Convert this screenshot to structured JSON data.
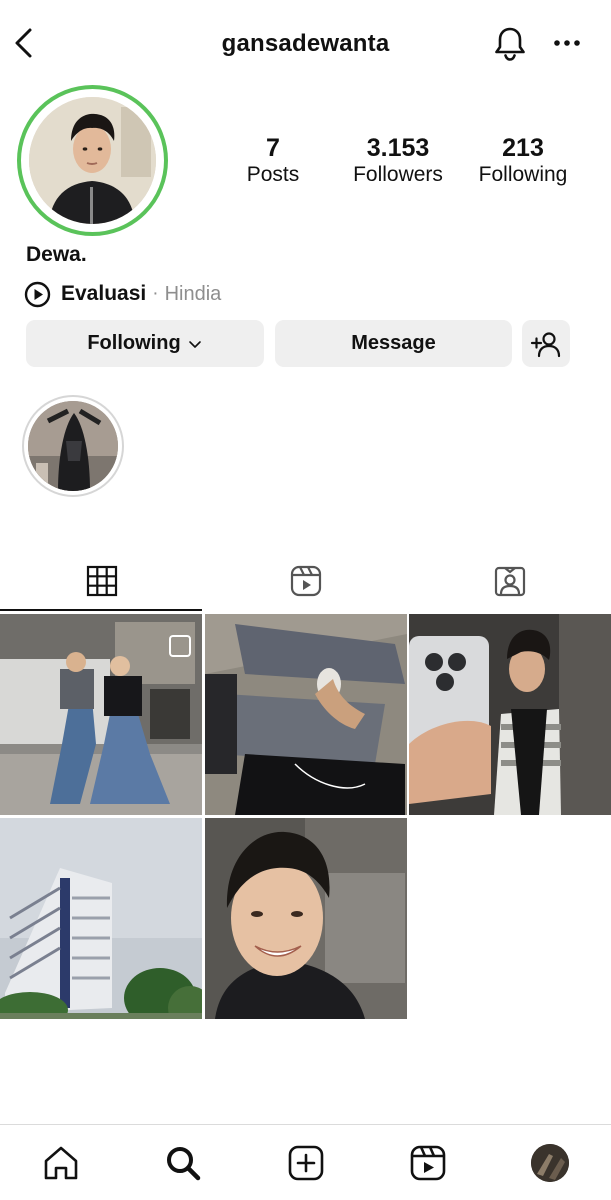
{
  "header": {
    "username": "gansadewanta",
    "icons": {
      "back": "chevron-left-icon",
      "notifications": "bell-icon",
      "more": "more-horizontal-icon"
    }
  },
  "profile": {
    "story_ring_color": "#5ac35a",
    "stats": {
      "posts": {
        "value": "7",
        "label": "Posts"
      },
      "followers": {
        "value": "3.153",
        "label": "Followers"
      },
      "following": {
        "value": "213",
        "label": "Following"
      }
    },
    "display_name": "Dewa.",
    "music": {
      "song": "Evaluasi",
      "separator": "·",
      "artist": "Hindia"
    }
  },
  "actions": {
    "following_label": "Following",
    "message_label": "Message",
    "add_user_icon": "add-user-icon"
  },
  "tabs": [
    {
      "name": "posts-grid",
      "icon": "grid-icon",
      "active": true
    },
    {
      "name": "reels",
      "icon": "reels-icon",
      "active": false
    },
    {
      "name": "tagged",
      "icon": "tagged-icon",
      "active": false
    }
  ],
  "bottom_nav": [
    {
      "name": "home",
      "icon": "home-icon"
    },
    {
      "name": "search",
      "icon": "search-icon"
    },
    {
      "name": "create",
      "icon": "plus-square-icon"
    },
    {
      "name": "reels",
      "icon": "reels-icon"
    },
    {
      "name": "profile",
      "icon": "avatar"
    }
  ],
  "colors": {
    "button_bg": "#efefef",
    "divider": "#dbdbdb",
    "secondary_text": "#8e8e8e"
  }
}
